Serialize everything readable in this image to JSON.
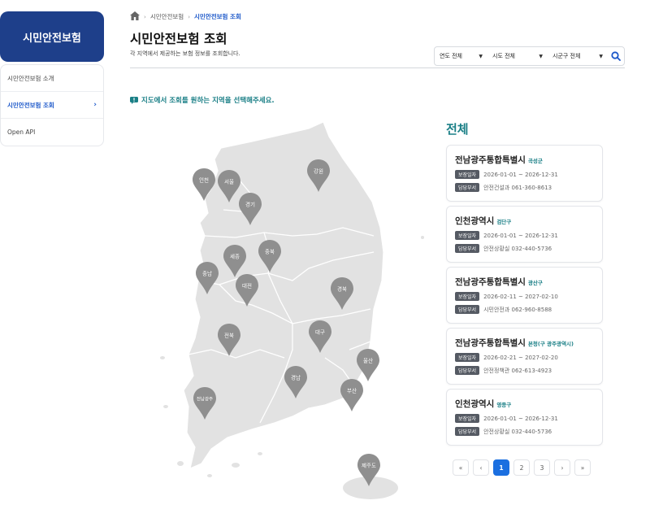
{
  "sidebar": {
    "title": "시민안전보험",
    "items": [
      {
        "label": "시민안전보험 소개"
      },
      {
        "label": "시민안전보험 조회",
        "chevron": "›"
      },
      {
        "label": "Open API"
      }
    ]
  },
  "breadcrumb": {
    "home_icon": "home-icon",
    "items": [
      "시민안전보험",
      "시민안전보험 조회"
    ],
    "separator": "›"
  },
  "header": {
    "title": "시민안전보험 조회",
    "subtitle": "각 지역에서 제공하는 보험 정보를 조회합니다."
  },
  "filters": {
    "year": "연도 전체",
    "province": "시도 전체",
    "district": "시군구 전체",
    "arrow": "▼",
    "search_icon": "search-icon"
  },
  "hint": "지도에서 조회를 원하는 지역을 선택해주세요.",
  "map": {
    "regions": [
      "인천",
      "서울",
      "경기",
      "강원",
      "세종",
      "충북",
      "충남",
      "대전",
      "경북",
      "대구",
      "전북",
      "울산",
      "경남",
      "부산",
      "전남광주",
      "제주도"
    ]
  },
  "results": {
    "title": "전체",
    "period_label": "보장일자",
    "dept_label": "담당부서",
    "cards": [
      {
        "name": "전남광주통합특별시",
        "district": "곡성군",
        "period": "2026-01-01 ~ 2026-12-31",
        "dept": "안전건설과 061-360-8613"
      },
      {
        "name": "인천광역시",
        "district": "검단구",
        "period": "2026-01-01 ~ 2026-12-31",
        "dept": "안전상황실 032-440-5736"
      },
      {
        "name": "전남광주통합특별시",
        "district": "광산구",
        "period": "2026-02-11 ~ 2027-02-10",
        "dept": "시민안전과 062-960-8588"
      },
      {
        "name": "전남광주통합특별시",
        "district": "본청(구 광주광역시)",
        "period": "2026-02-21 ~ 2027-02-20",
        "dept": "안전정책관 062-613-4923"
      },
      {
        "name": "인천광역시",
        "district": "영종구",
        "period": "2026-01-01 ~ 2026-12-31",
        "dept": "안전상황실 032-440-5736"
      }
    ]
  },
  "pagination": {
    "first": "«",
    "prev": "‹",
    "pages": [
      "1",
      "2",
      "3"
    ],
    "next": "›",
    "last": "»",
    "current": "1"
  },
  "colors": {
    "primary": "#1e3f8a",
    "accent": "#1a7f86",
    "active_page": "#1b6fe0",
    "map_fill": "#e3e3e3",
    "marker": "#8f8f8f"
  }
}
